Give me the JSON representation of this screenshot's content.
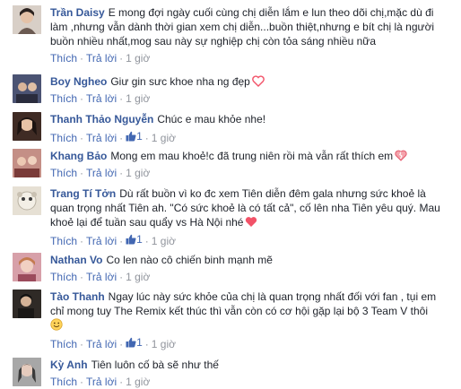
{
  "comments": [
    {
      "name": "Trần Daisy",
      "text": "E mong đợi ngày cuối cùng chị diễn lắm e lun theo dõi chị,mặc dù đi làm ,nhưng vẫn dành thời gian xem chị diễn...buồn thiệt,nhưng e bít chị là người buồn nhiều nhất,mog sau này sự nghiệp chị còn tỏa sáng nhiều nữa",
      "like_label": "Thích",
      "reply_label": "Trả lời",
      "time": "1 giờ",
      "likes": "",
      "emoji": "",
      "avatar_color": "#b9a79a"
    },
    {
      "name": "Boy Ngheo",
      "text": "Giư gin sưc khoe nha ng đẹp",
      "like_label": "Thích",
      "reply_label": "Trả lời",
      "time": "1 giờ",
      "likes": "",
      "emoji": "heart-icon",
      "avatar_color": "#5a5f7a"
    },
    {
      "name": "Thanh Thảo Nguyễn",
      "text": "Chúc e mau khỏe nhe!",
      "like_label": "Thích",
      "reply_label": "Trả lời",
      "time": "1 giờ",
      "likes": "1",
      "emoji": "",
      "avatar_color": "#6b4a3c"
    },
    {
      "name": "Khang Bảo",
      "text": "Mong em mau khoẻ!c đã trung niên rồi mà vẫn rất thích em",
      "like_label": "Thích",
      "reply_label": "Trả lời",
      "time": "1 giờ",
      "likes": "",
      "emoji": "broken-heart-icon",
      "avatar_color": "#9a6b62"
    },
    {
      "name": "Trang Tí Tởn",
      "text": "Dù rất buồn vì ko đc xem Tiên diễn đêm gala nhưng sức khoẻ là quan trọng nhất Tiên ah. \"Có sức khoẻ là có tất cả\", cố lên nha Tiên yêu quý. Mau khoẻ lại để tuần sau quẩy vs Hà Nội nhé",
      "like_label": "Thích",
      "reply_label": "Trả lời",
      "time": "1 giờ",
      "likes": "1",
      "emoji": "heart-icon",
      "avatar_color": "#d9d2c4"
    },
    {
      "name": "Nathan Vo",
      "text": "Co len nào cô chiến binh mạnh mẽ",
      "like_label": "Thích",
      "reply_label": "Trả lời",
      "time": "1 giờ",
      "likes": "",
      "emoji": "",
      "avatar_color": "#b77a86"
    },
    {
      "name": "Tào Thanh",
      "text": "Ngay lúc này sức khỏe của chị là quan trọng nhất đối với fan , tụi em chỉ mong tuy The Remix kết thúc thì vẫn còn có cơ hội gặp lại bộ 3 Team V thôi",
      "like_label": "Thích",
      "reply_label": "Trả lời",
      "time": "1 giờ",
      "likes": "1",
      "emoji": "smile-icon",
      "avatar_color": "#3d3631"
    },
    {
      "name": "Kỳ Anh",
      "text": "Tiên luôn cố bà sẽ như thế",
      "like_label": "Thích",
      "reply_label": "Trả lời",
      "time": "1 giờ",
      "likes": "",
      "emoji": "",
      "avatar_color": "#8b8b8b"
    }
  ]
}
